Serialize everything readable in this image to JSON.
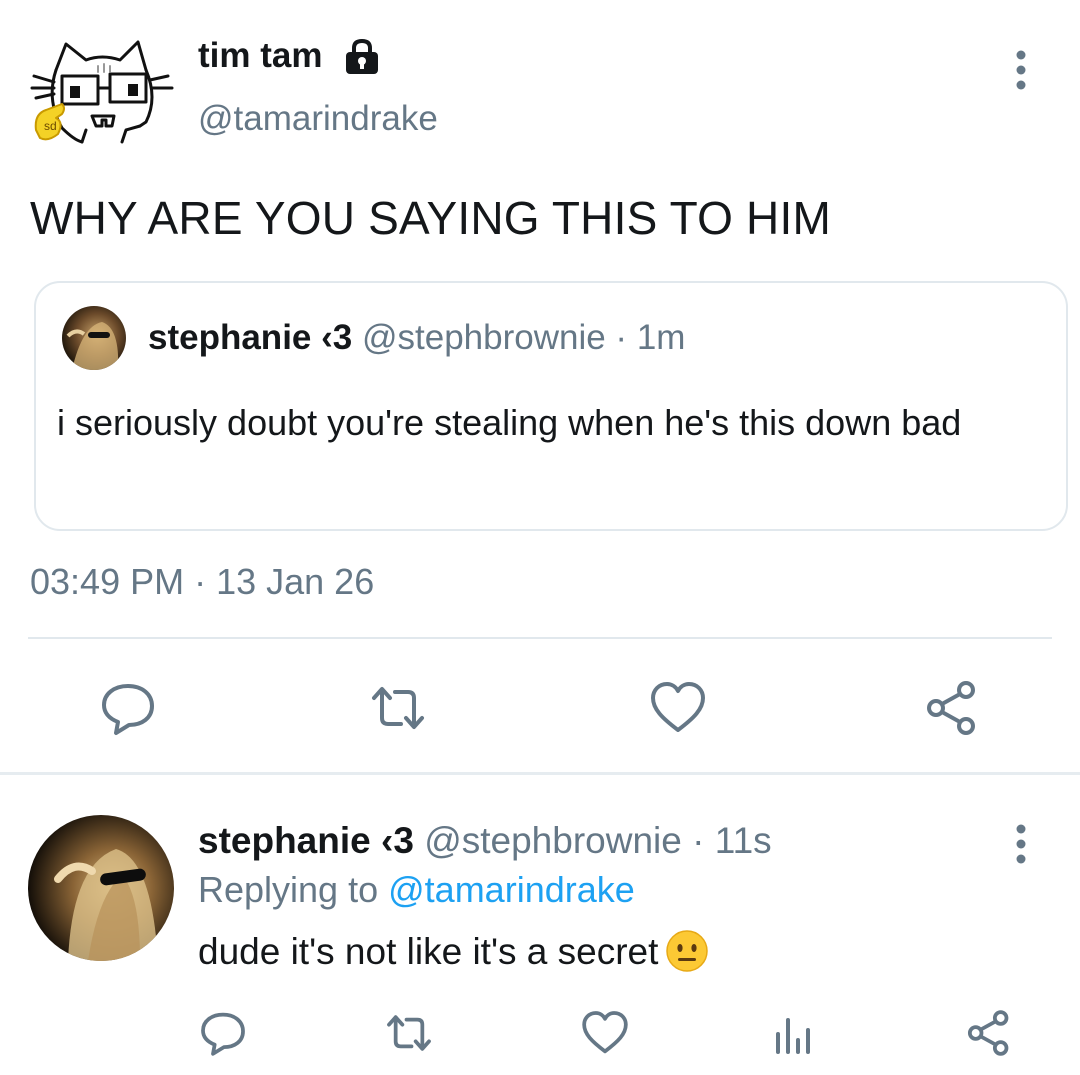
{
  "main_tweet": {
    "display_name": "tim tam",
    "handle": "@tamarindrake",
    "text": "WHY ARE YOU SAYING THIS TO HIM",
    "timestamp": "03:49 PM · 13 Jan 26",
    "icons": [
      "lock-icon",
      "more-vertical-icon",
      "reply-icon",
      "retweet-icon",
      "like-icon",
      "share-icon"
    ]
  },
  "quoted_tweet": {
    "display_name": "stephanie ‹3",
    "handle": "@stephbrownie",
    "separator": "·",
    "time": "1m",
    "text": "i seriously doubt you're stealing when he's this down bad"
  },
  "reply_tweet": {
    "display_name": "stephanie ‹3",
    "handle": "@stephbrownie",
    "separator": "·",
    "time": "11s",
    "replying_prefix": "Replying to",
    "replying_to": "@tamarindrake",
    "text": "dude it's not like it's a secret",
    "emoji": "neutral-face",
    "icons": [
      "reply-icon",
      "retweet-icon",
      "like-icon",
      "views-icon",
      "share-icon"
    ]
  },
  "colors": {
    "text": "#14171a",
    "muted": "#657786",
    "link": "#1da1f2",
    "border": "#e1e8ed"
  }
}
